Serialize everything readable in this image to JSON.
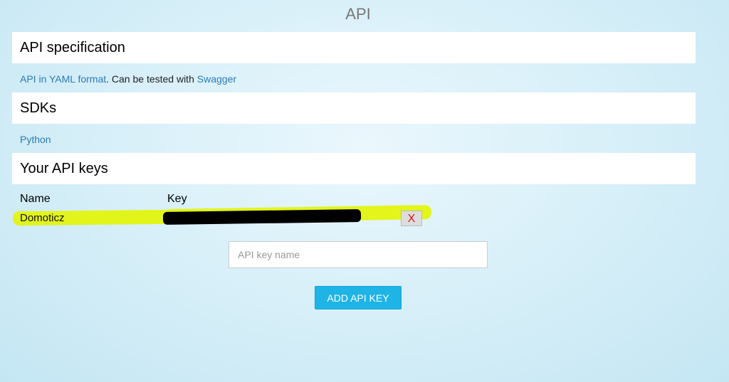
{
  "page": {
    "title": "API"
  },
  "spec": {
    "header": "API specification",
    "yaml_link": "API in YAML format",
    "middle_text": ". Can be tested with ",
    "swagger_link": "Swagger"
  },
  "sdks": {
    "header": "SDKs",
    "python_link": "Python"
  },
  "keys": {
    "header": "Your API keys",
    "col_name": "Name",
    "col_key": "Key",
    "rows": [
      {
        "name": "Domoticz",
        "delete_label": "X"
      }
    ]
  },
  "form": {
    "placeholder": "API key name",
    "value": "",
    "add_label": "ADD API KEY"
  },
  "colors": {
    "link": "#2a7bb6",
    "highlight": "#e3f40f",
    "add_button": "#1eb4e6",
    "delete_x": "#e01010"
  }
}
